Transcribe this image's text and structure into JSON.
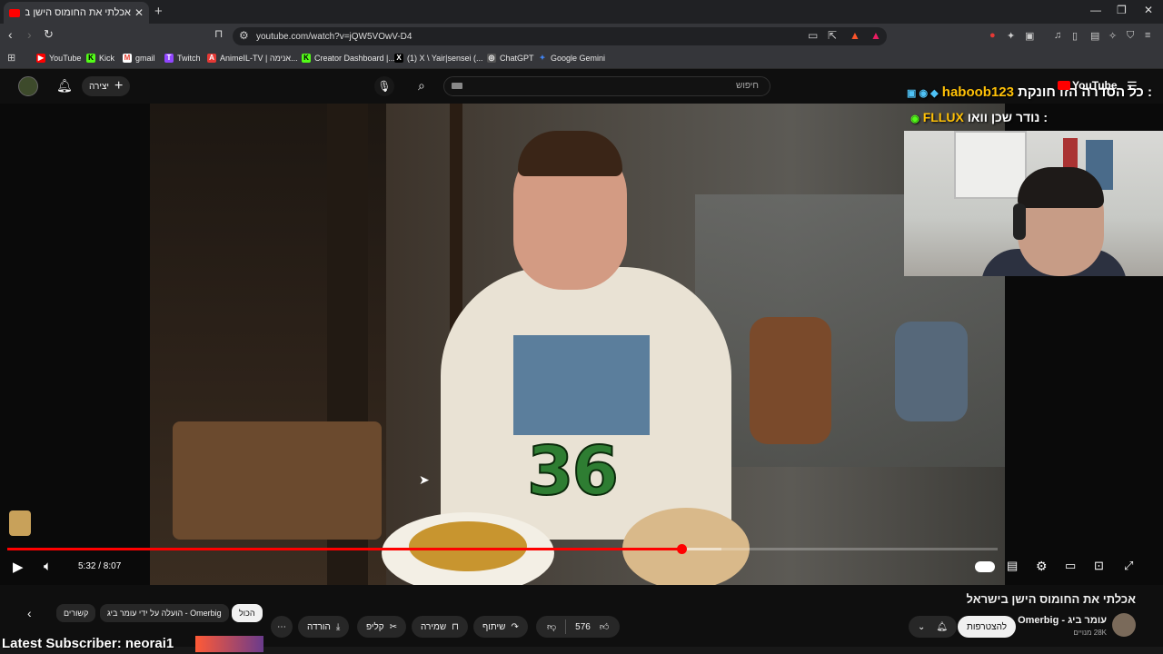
{
  "browser": {
    "tab_title": "אכלתי את החומוס הישן בישראל",
    "url": "youtube.com/watch?v=jQW5VOwV-D4",
    "bookmarks": [
      {
        "label": "YouTube",
        "icon_color": "#ff0000",
        "icon": "youtube-icon"
      },
      {
        "label": "Kick",
        "icon_color": "#53fc18",
        "icon": "kick-icon"
      },
      {
        "label": "gmail",
        "icon_color": "#ea4335",
        "icon": "gmail-icon"
      },
      {
        "label": "Twitch",
        "icon_color": "#9146ff",
        "icon": "twitch-icon"
      },
      {
        "label": "AnimeIL-TV | אנימה...",
        "icon_color": "#e53935",
        "icon": "animeil-icon"
      },
      {
        "label": "Creator Dashboard |...",
        "icon_color": "#53fc18",
        "icon": "kick-icon"
      },
      {
        "label": "(1) X \\ Yair|sensei (...",
        "icon_color": "#000000",
        "icon": "x-icon"
      },
      {
        "label": "ChatGPT",
        "icon_color": "#444444",
        "icon": "chatgpt-icon"
      },
      {
        "label": "Google Gemini",
        "icon_color": "#4285f4",
        "icon": "gemini-icon"
      }
    ]
  },
  "youtube": {
    "create_label": "יצירה",
    "search_placeholder": "חיפוש",
    "logo_text": "YouTube"
  },
  "overlay": {
    "line1_prefix": "כל הסדרה הזו חונקת :",
    "line1_name": "haboob123",
    "line2_text": "נודר שכן וואו :",
    "line2_name": "FLLUX",
    "subscriber_text": "Latest Subscriber: neorai1"
  },
  "video_overlay_number": "36",
  "player": {
    "time": "5:32 / 8:07",
    "progress_fraction": 0.681
  },
  "below": {
    "title": "אכלתי את החומוס הישן בישראל",
    "channel": "Omerbig - עומר ביג",
    "subs": "28K מנויים",
    "join": "להצטרפות",
    "likes": "576",
    "share": "שיתוף",
    "save": "שמירה",
    "clip": "קליפ",
    "download": "הורדה",
    "chips": [
      "הכול",
      "הועלה על ידי עומר ביג - Omerbig",
      "קשורים"
    ]
  },
  "colors": {
    "accent": "#ff0000",
    "overlay_name": "#ffc107",
    "number": "#2e7d32"
  }
}
